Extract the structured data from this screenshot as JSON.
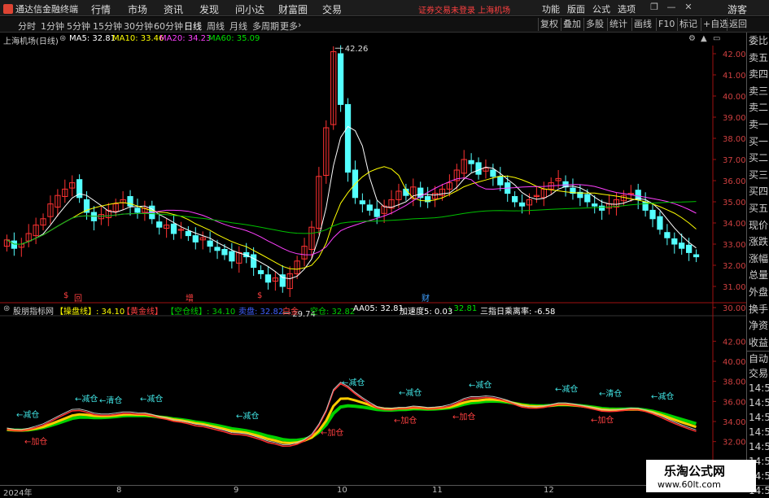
{
  "titlebar": {
    "app_name": "通达信金融终端",
    "menu": [
      "行情",
      "市场",
      "资讯",
      "发现",
      "问小达",
      "财富圈",
      "交易"
    ],
    "warning": "证券交易未登录 上海机场",
    "right_menu": [
      "功能",
      "版面",
      "公式",
      "选项"
    ],
    "user": "游客"
  },
  "periods": [
    "分时",
    "1分钟",
    "5分钟",
    "15分钟",
    "30分钟",
    "60分钟",
    "日线",
    "周线",
    "月线",
    "多周期",
    "更多"
  ],
  "active_period": "日线",
  "toolbar": [
    "复权",
    "叠加",
    "多股",
    "统计",
    "画线",
    "F10",
    "标记",
    "+自选",
    "返回"
  ],
  "main": {
    "stock_title": "上海机场(日线)",
    "ma": [
      {
        "label": "MA5: 32.81",
        "color": "#ffffff"
      },
      {
        "label": "MA10: 33.46",
        "color": "#ffff00"
      },
      {
        "label": "MA20: 34.23",
        "color": "#ff40ff"
      },
      {
        "label": "MA60: 35.09",
        "color": "#00e000"
      }
    ],
    "high_label": "42.26",
    "low_label": "29.74",
    "tags": [
      "回",
      "增",
      "财"
    ]
  },
  "price_axis": [
    "42.00",
    "41.00",
    "40.00",
    "39.00",
    "38.00",
    "37.00",
    "36.00",
    "35.00",
    "34.00",
    "33.00",
    "32.00",
    "31.00",
    "30.00"
  ],
  "sidepanel": [
    "委比",
    "卖五",
    "卖四",
    "卖三",
    "卖二",
    "卖一",
    "买一",
    "买二",
    "买三",
    "买四",
    "买五",
    "现价",
    "涨跌",
    "涨幅",
    "总量",
    "外盘",
    "换手",
    "净资",
    "收益"
  ],
  "sidepanel_bottom": [
    "自动",
    "交易",
    "14:56",
    "14:56",
    "14:56",
    "14:56",
    "14:56",
    "14:56",
    "14:56",
    "14:56"
  ],
  "indicator": {
    "name": "股朋指标网",
    "items": [
      {
        "label": "【操盘线】: 34.10",
        "color": "#ffff00"
      },
      {
        "label": "【黄金线】",
        "color": "#ff4040"
      },
      {
        "label": "【空仓线】: 34.10",
        "color": "#00d000"
      },
      {
        "label": "卖盘: 32.82",
        "color": "#4060ff"
      },
      {
        "label": "白金",
        "color": "#ff4040"
      },
      {
        "label": "空仓: 32.82",
        "color": "#00d000"
      },
      {
        "label": "AA05: 32.81",
        "color": "#ffffff"
      },
      {
        "label": "加速度5: 0.03",
        "color": "#ffffff"
      },
      {
        "label": ": 32.81",
        "color": "#00e000"
      },
      {
        "label": "三指日乘离率: -6.58",
        "color": "#ffffff"
      }
    ],
    "axis": [
      "42.00",
      "40.00",
      "38.00",
      "36.00",
      "34.00",
      "32.00"
    ],
    "signals": {
      "reduce": "←减仓",
      "clear": "←清仓",
      "add": "←加仓"
    }
  },
  "dates": [
    "2024年",
    "8",
    "9",
    "10",
    "11",
    "12"
  ],
  "watermark": {
    "line1": "乐淘公式网",
    "line2": "www.60lt.com"
  },
  "chart_data": {
    "type": "candlestick",
    "series_name": "上海机场(日线)",
    "close": [
      33.2,
      32.8,
      33.0,
      33.5,
      33.9,
      34.2,
      34.9,
      35.3,
      35.6,
      35.9,
      35.2,
      34.5,
      34.1,
      34.4,
      34.6,
      34.9,
      35.1,
      34.8,
      34.5,
      34.7,
      34.2,
      33.8,
      33.9,
      33.5,
      33.7,
      33.4,
      33.1,
      33.3,
      32.9,
      32.7,
      32.5,
      32.2,
      32.6,
      32.4,
      31.9,
      31.6,
      31.2,
      31.4,
      31.0,
      31.6,
      32.2,
      32.9,
      33.8,
      36.2,
      38.5,
      42.1,
      39.6,
      36.4,
      35.2,
      34.9,
      34.6,
      34.3,
      34.8,
      35.1,
      35.5,
      35.3,
      35.7,
      35.2,
      35.0,
      35.4,
      35.6,
      35.9,
      36.5,
      37.0,
      36.8,
      36.3,
      36.6,
      36.2,
      35.8,
      35.4,
      35.0,
      34.8,
      35.1,
      35.3,
      35.6,
      35.9,
      36.1,
      35.7,
      35.4,
      35.2,
      35.0,
      34.8,
      34.6,
      34.9,
      35.1,
      35.3,
      35.4,
      35.1,
      34.6,
      34.2,
      33.7,
      33.3,
      33.0,
      32.8,
      32.6,
      32.4
    ],
    "ma_values": {
      "MA5": 32.81,
      "MA10": 33.46,
      "MA20": 34.23,
      "MA60": 35.09
    },
    "indicator_values": {
      "操盘线": 34.1,
      "空仓线": 34.1,
      "AA05": 32.81,
      "加速度5": 0.03,
      "三指日乘离率": -6.58
    }
  }
}
